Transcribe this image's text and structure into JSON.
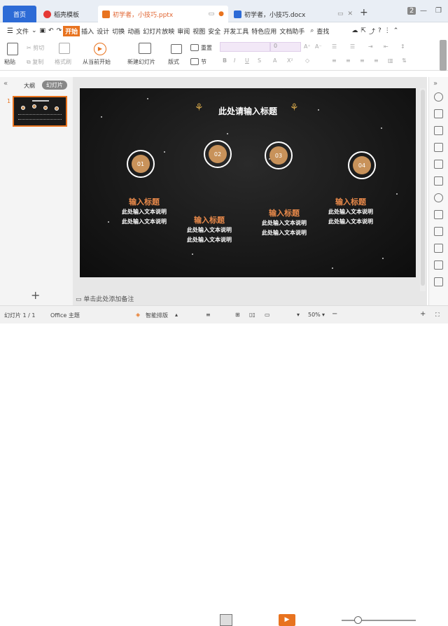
{
  "tabs": {
    "home": "首页",
    "templates": "稻壳模板",
    "ppt": "初学者，小技巧.pptx",
    "doc": "初学者，小技巧.docx"
  },
  "window": {
    "badge": "2"
  },
  "menu": {
    "file": "文件",
    "items": [
      "开始",
      "插入",
      "设计",
      "切换",
      "动画",
      "幻灯片放映",
      "审阅",
      "视图",
      "安全",
      "开发工具",
      "特色应用",
      "文档助手"
    ],
    "search": "查找"
  },
  "ribbon": {
    "paste": "粘贴",
    "cut": "剪切",
    "copy": "复制",
    "format_painter": "格式刷",
    "from_current": "从当前开始",
    "new_slide": "新建幻灯片",
    "layout": "版式",
    "reset": "重置",
    "section": "节",
    "font_size": "0"
  },
  "left_panel": {
    "tab_outline": "大纲",
    "tab_slides": "幻灯片",
    "thumb_number": "1",
    "add": "+"
  },
  "slide": {
    "title": "此处请输入标题",
    "points": [
      {
        "num": "01",
        "title": "输入标题",
        "desc1": "此处输入文本说明",
        "desc2": "此处输入文本说明"
      },
      {
        "num": "02",
        "title": "输入标题",
        "desc1": "此处输入文本说明",
        "desc2": "此处输入文本说明"
      },
      {
        "num": "03",
        "title": "输入标题",
        "desc1": "此处输入文本说明",
        "desc2": "此处输入文本说明"
      },
      {
        "num": "04",
        "title": "输入标题",
        "desc1": "此处输入文本说明",
        "desc2": "此处输入文本说明"
      }
    ]
  },
  "notes": "单击此处添加备注",
  "status": {
    "slide_info": "幻灯片 1 / 1",
    "theme": "Office 主题",
    "smart_layout": "智能排版",
    "zoom": "50%"
  },
  "colors": {
    "accent": "#e8731f",
    "home_tab": "#2d6bd6",
    "circle_fill": "#c8925a",
    "point_title": "#e8894a"
  }
}
